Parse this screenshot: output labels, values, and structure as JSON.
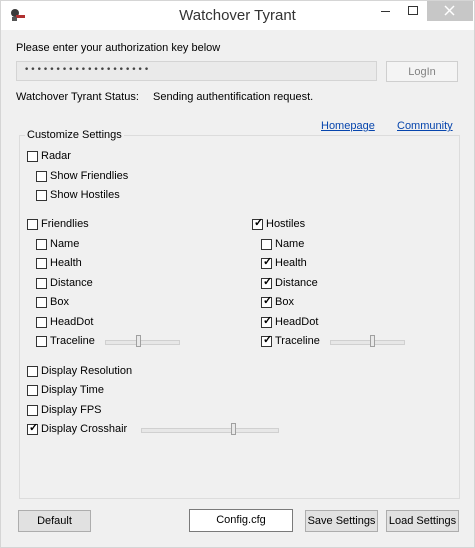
{
  "window": {
    "title": "Watchover Tyrant"
  },
  "login": {
    "prompt": "Please enter your authorization key below",
    "key_value": "••••••••••••••••••••",
    "login_button": "LogIn",
    "status_label": "Watchover Tyrant Status:",
    "status_value": "Sending authentification request."
  },
  "links": {
    "homepage": "Homepage",
    "community": "Community"
  },
  "settings": {
    "legend": "Customize Settings",
    "radar": {
      "label": "Radar",
      "checked": false
    },
    "show_friendlies": {
      "label": "Show Friendlies",
      "checked": false
    },
    "show_hostiles": {
      "label": "Show Hostiles",
      "checked": false
    },
    "friendlies": {
      "label": "Friendlies",
      "checked": false,
      "items": [
        {
          "label": "Name",
          "checked": false
        },
        {
          "label": "Health",
          "checked": false
        },
        {
          "label": "Distance",
          "checked": false
        },
        {
          "label": "Box",
          "checked": false
        },
        {
          "label": "HeadDot",
          "checked": false
        },
        {
          "label": "Traceline",
          "checked": false
        }
      ],
      "traceline_slider": 0.45
    },
    "hostiles": {
      "label": "Hostiles",
      "checked": true,
      "items": [
        {
          "label": "Name",
          "checked": false
        },
        {
          "label": "Health",
          "checked": true
        },
        {
          "label": "Distance",
          "checked": true
        },
        {
          "label": "Box",
          "checked": true
        },
        {
          "label": "HeadDot",
          "checked": true
        },
        {
          "label": "Traceline",
          "checked": true
        }
      ],
      "traceline_slider": 0.58
    },
    "display": [
      {
        "label": "Display Resolution",
        "checked": false
      },
      {
        "label": "Display Time",
        "checked": false
      },
      {
        "label": "Display FPS",
        "checked": false
      },
      {
        "label": "Display Crosshair",
        "checked": true
      }
    ],
    "crosshair_slider": 0.68
  },
  "footer": {
    "default_button": "Default",
    "config_file": "Config.cfg",
    "save_button": "Save Settings",
    "load_button": "Load Settings"
  },
  "icons": {
    "app": "tyrant-app-icon",
    "minimize": "minimize-icon",
    "maximize": "maximize-icon",
    "close": "close-icon"
  },
  "colors": {
    "link": "#0645ad",
    "close_button": "#c7c7c7",
    "background": "#f0f0f0"
  }
}
